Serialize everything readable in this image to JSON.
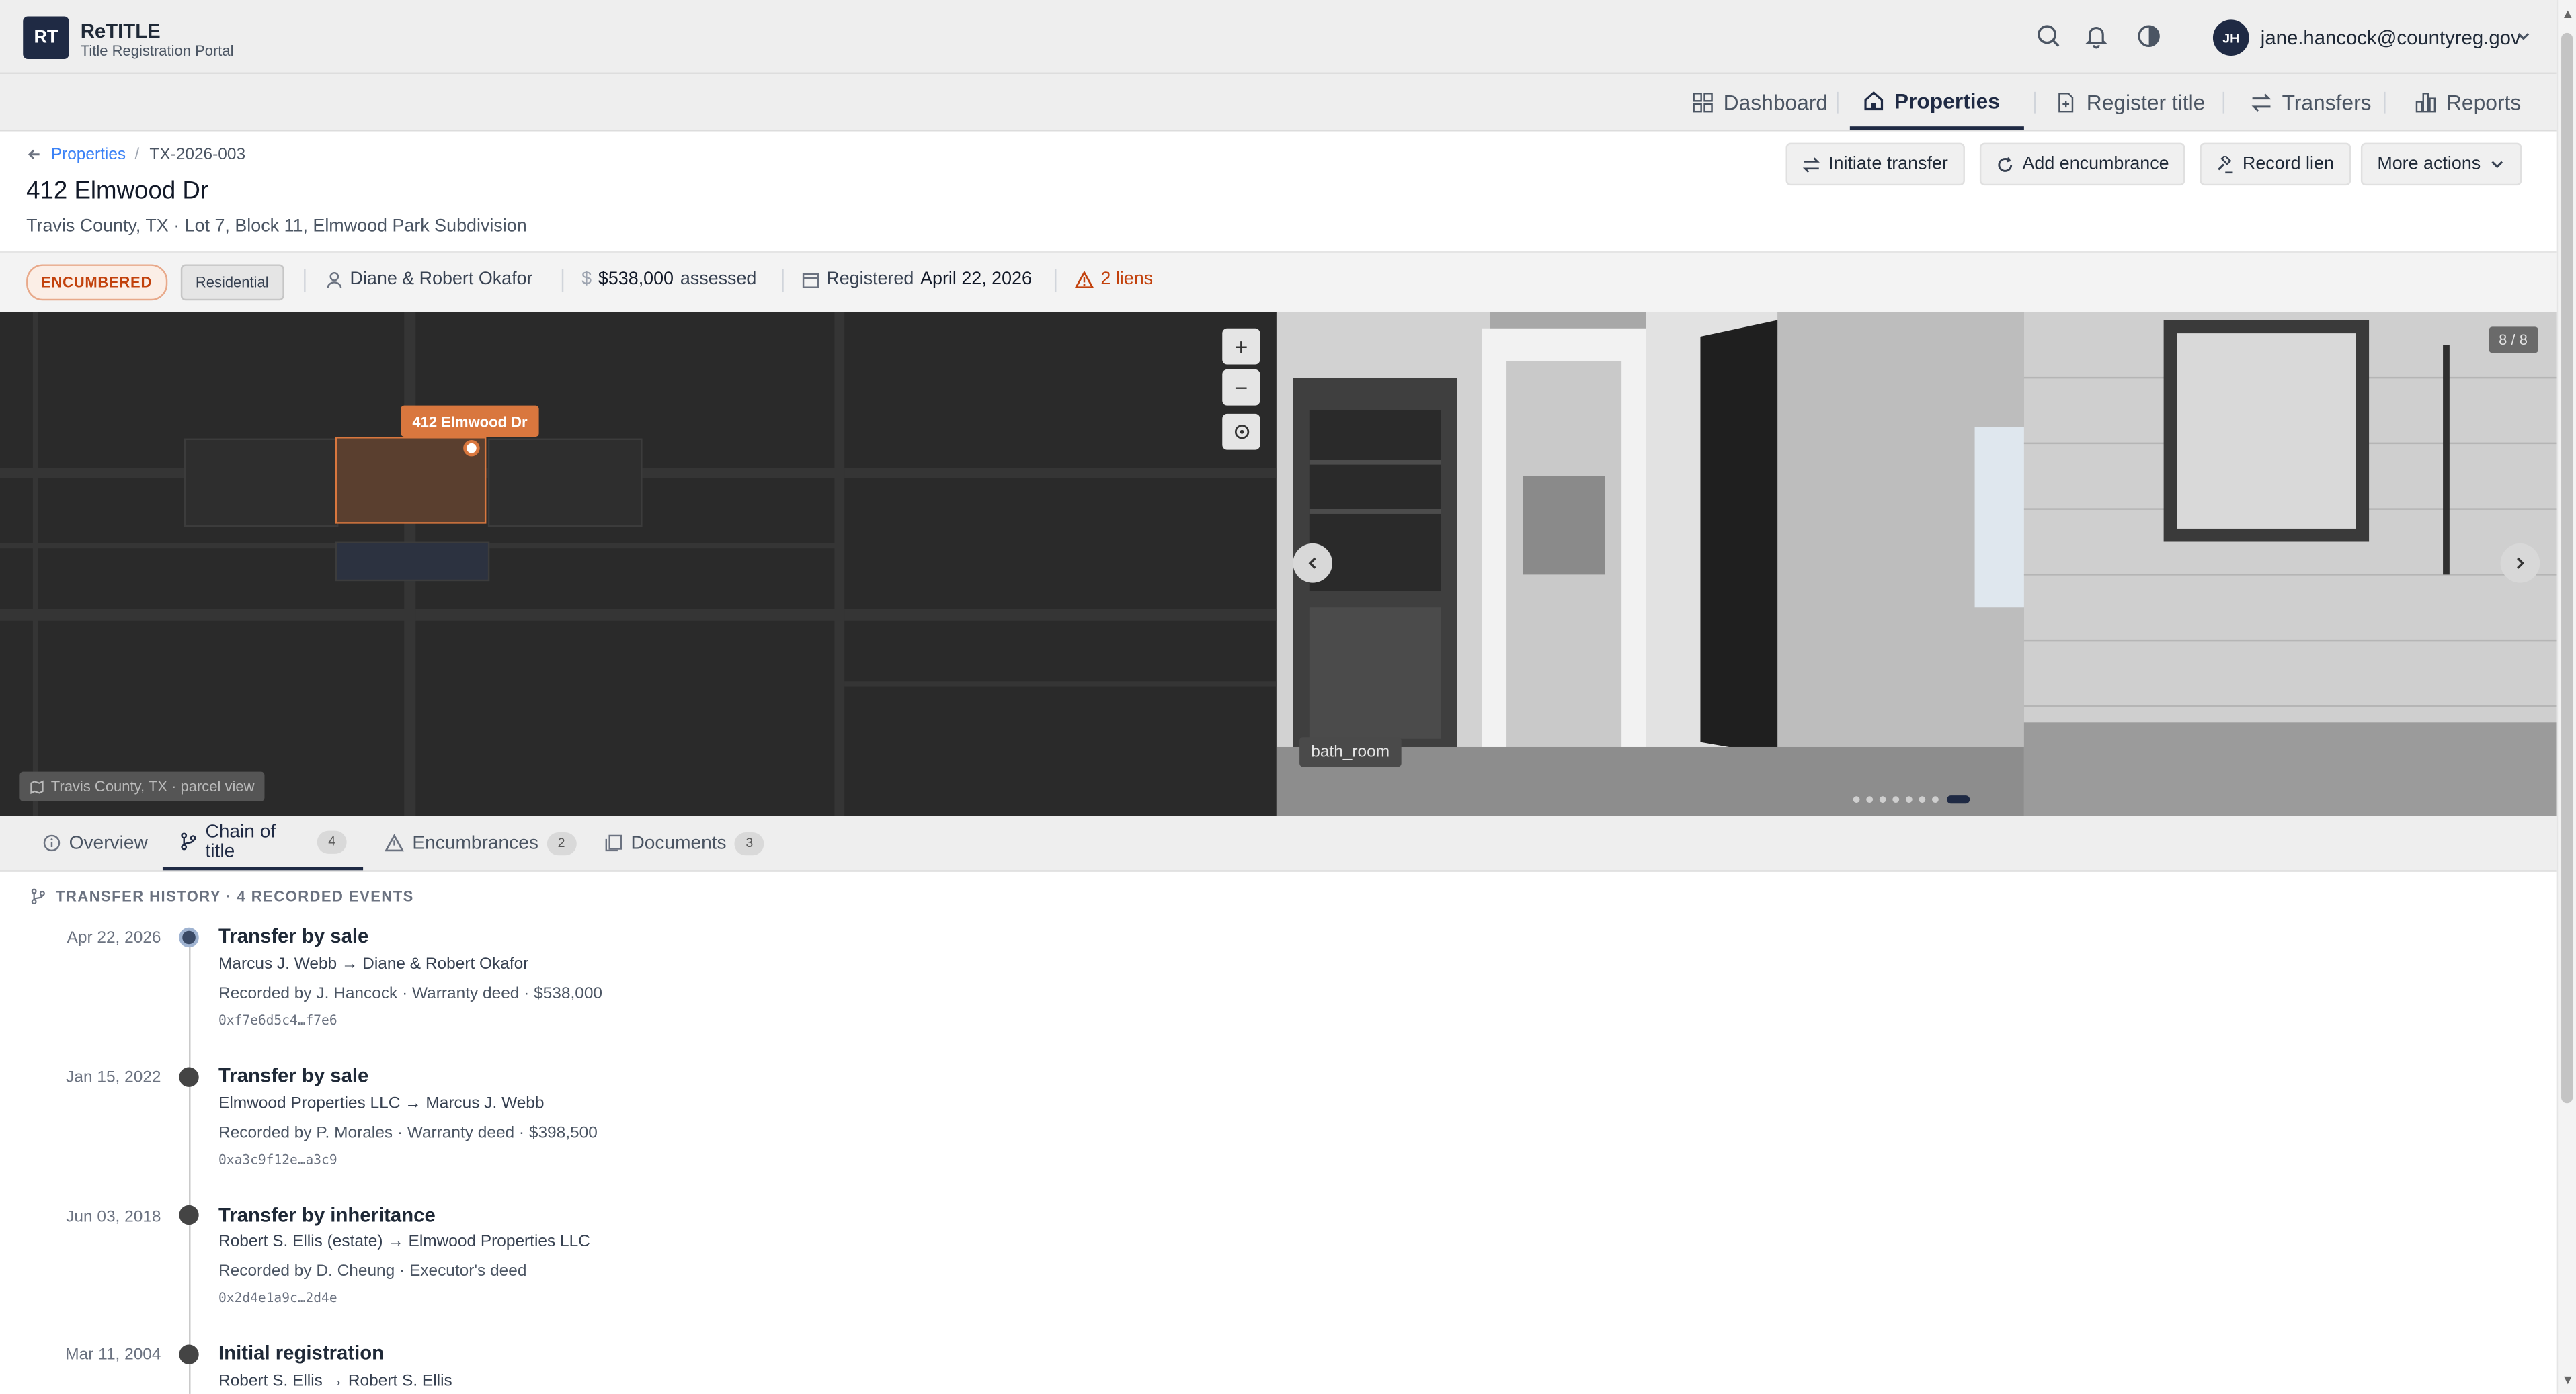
{
  "app": {
    "logo_text": "RT",
    "name": "ReTITLE",
    "subtitle": "Title Registration Portal"
  },
  "user": {
    "initials": "JH",
    "email": "jane.hancock@countyreg.gov"
  },
  "nav": {
    "dashboard": "Dashboard",
    "properties": "Properties",
    "register": "Register title",
    "transfers": "Transfers",
    "reports": "Reports"
  },
  "breadcrumb": {
    "parent": "Properties",
    "separator": "/",
    "current": "TX-2026-003"
  },
  "property": {
    "address": "412 Elmwood Dr",
    "legal": "Travis County, TX · Lot 7, Block 11, Elmwood Park Subdivision",
    "status": "ENCUMBERED",
    "type": "Residential",
    "owners": "Diane & Robert Okafor",
    "assessed_value": "$538,000",
    "assessed_label": "assessed",
    "registered_label": "Registered",
    "registered_date": "April 22, 2026",
    "liens": "2 liens"
  },
  "actions": {
    "initiate": "Initiate transfer",
    "encumbrance": "Add encumbrance",
    "lien": "Record lien",
    "more": "More actions"
  },
  "map": {
    "pin_label": "412 Elmwood Dr",
    "caption": "Travis County, TX · parcel view",
    "zoom_in": "+",
    "zoom_out": "−"
  },
  "gallery": {
    "counter": "8 / 8",
    "caption": "bath_room",
    "current": 8,
    "total": 8
  },
  "tabs": [
    {
      "label": "Overview",
      "count": ""
    },
    {
      "label": "Chain of title",
      "count": "4"
    },
    {
      "label": "Encumbrances",
      "count": "2"
    },
    {
      "label": "Documents",
      "count": "3"
    }
  ],
  "history": {
    "heading": "TRANSFER HISTORY · 4 RECORDED EVENTS",
    "events": [
      {
        "date": "Apr 22, 2026",
        "title": "Transfer by sale",
        "parties": "Marcus J. Webb → Diane & Robert Okafor",
        "record": "Recorded by J. Hancock · Warranty deed · $538,000",
        "hash": "0xf7e6d5c4…f7e6"
      },
      {
        "date": "Jan 15, 2022",
        "title": "Transfer by sale",
        "parties": "Elmwood Properties LLC → Marcus J. Webb",
        "record": "Recorded by P. Morales · Warranty deed · $398,500",
        "hash": "0xa3c9f12e…a3c9"
      },
      {
        "date": "Jun 03, 2018",
        "title": "Transfer by inheritance",
        "parties": "Robert S. Ellis (estate) → Elmwood Properties LLC",
        "record": "Recorded by D. Cheung · Executor's deed",
        "hash": "0x2d4e1a9c…2d4e"
      },
      {
        "date": "Mar 11, 2004",
        "title": "Initial registration",
        "parties": "Robert S. Ellis → Robert S. Ellis",
        "record": "",
        "hash": ""
      }
    ]
  },
  "colors": {
    "brand": "#1f2a44",
    "accent_orange": "#d9773e",
    "encumbered": "#c2410c",
    "link": "#2563eb"
  }
}
